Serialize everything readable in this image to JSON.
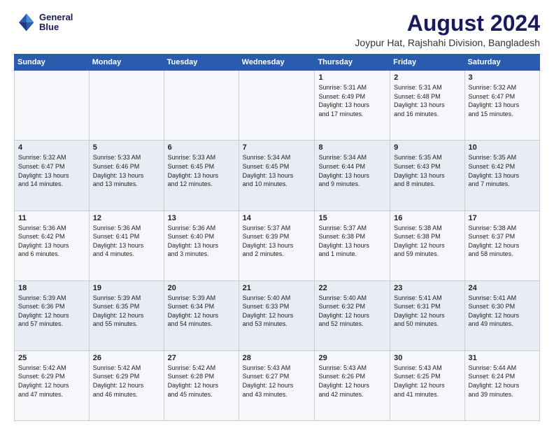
{
  "logo": {
    "line1": "General",
    "line2": "Blue"
  },
  "title": "August 2024",
  "subtitle": "Joypur Hat, Rajshahi Division, Bangladesh",
  "header_days": [
    "Sunday",
    "Monday",
    "Tuesday",
    "Wednesday",
    "Thursday",
    "Friday",
    "Saturday"
  ],
  "weeks": [
    [
      {
        "num": "",
        "info": ""
      },
      {
        "num": "",
        "info": ""
      },
      {
        "num": "",
        "info": ""
      },
      {
        "num": "",
        "info": ""
      },
      {
        "num": "1",
        "info": "Sunrise: 5:31 AM\nSunset: 6:49 PM\nDaylight: 13 hours\nand 17 minutes."
      },
      {
        "num": "2",
        "info": "Sunrise: 5:31 AM\nSunset: 6:48 PM\nDaylight: 13 hours\nand 16 minutes."
      },
      {
        "num": "3",
        "info": "Sunrise: 5:32 AM\nSunset: 6:47 PM\nDaylight: 13 hours\nand 15 minutes."
      }
    ],
    [
      {
        "num": "4",
        "info": "Sunrise: 5:32 AM\nSunset: 6:47 PM\nDaylight: 13 hours\nand 14 minutes."
      },
      {
        "num": "5",
        "info": "Sunrise: 5:33 AM\nSunset: 6:46 PM\nDaylight: 13 hours\nand 13 minutes."
      },
      {
        "num": "6",
        "info": "Sunrise: 5:33 AM\nSunset: 6:45 PM\nDaylight: 13 hours\nand 12 minutes."
      },
      {
        "num": "7",
        "info": "Sunrise: 5:34 AM\nSunset: 6:45 PM\nDaylight: 13 hours\nand 10 minutes."
      },
      {
        "num": "8",
        "info": "Sunrise: 5:34 AM\nSunset: 6:44 PM\nDaylight: 13 hours\nand 9 minutes."
      },
      {
        "num": "9",
        "info": "Sunrise: 5:35 AM\nSunset: 6:43 PM\nDaylight: 13 hours\nand 8 minutes."
      },
      {
        "num": "10",
        "info": "Sunrise: 5:35 AM\nSunset: 6:42 PM\nDaylight: 13 hours\nand 7 minutes."
      }
    ],
    [
      {
        "num": "11",
        "info": "Sunrise: 5:36 AM\nSunset: 6:42 PM\nDaylight: 13 hours\nand 6 minutes."
      },
      {
        "num": "12",
        "info": "Sunrise: 5:36 AM\nSunset: 6:41 PM\nDaylight: 13 hours\nand 4 minutes."
      },
      {
        "num": "13",
        "info": "Sunrise: 5:36 AM\nSunset: 6:40 PM\nDaylight: 13 hours\nand 3 minutes."
      },
      {
        "num": "14",
        "info": "Sunrise: 5:37 AM\nSunset: 6:39 PM\nDaylight: 13 hours\nand 2 minutes."
      },
      {
        "num": "15",
        "info": "Sunrise: 5:37 AM\nSunset: 6:38 PM\nDaylight: 13 hours\nand 1 minute."
      },
      {
        "num": "16",
        "info": "Sunrise: 5:38 AM\nSunset: 6:38 PM\nDaylight: 12 hours\nand 59 minutes."
      },
      {
        "num": "17",
        "info": "Sunrise: 5:38 AM\nSunset: 6:37 PM\nDaylight: 12 hours\nand 58 minutes."
      }
    ],
    [
      {
        "num": "18",
        "info": "Sunrise: 5:39 AM\nSunset: 6:36 PM\nDaylight: 12 hours\nand 57 minutes."
      },
      {
        "num": "19",
        "info": "Sunrise: 5:39 AM\nSunset: 6:35 PM\nDaylight: 12 hours\nand 55 minutes."
      },
      {
        "num": "20",
        "info": "Sunrise: 5:39 AM\nSunset: 6:34 PM\nDaylight: 12 hours\nand 54 minutes."
      },
      {
        "num": "21",
        "info": "Sunrise: 5:40 AM\nSunset: 6:33 PM\nDaylight: 12 hours\nand 53 minutes."
      },
      {
        "num": "22",
        "info": "Sunrise: 5:40 AM\nSunset: 6:32 PM\nDaylight: 12 hours\nand 52 minutes."
      },
      {
        "num": "23",
        "info": "Sunrise: 5:41 AM\nSunset: 6:31 PM\nDaylight: 12 hours\nand 50 minutes."
      },
      {
        "num": "24",
        "info": "Sunrise: 5:41 AM\nSunset: 6:30 PM\nDaylight: 12 hours\nand 49 minutes."
      }
    ],
    [
      {
        "num": "25",
        "info": "Sunrise: 5:42 AM\nSunset: 6:29 PM\nDaylight: 12 hours\nand 47 minutes."
      },
      {
        "num": "26",
        "info": "Sunrise: 5:42 AM\nSunset: 6:29 PM\nDaylight: 12 hours\nand 46 minutes."
      },
      {
        "num": "27",
        "info": "Sunrise: 5:42 AM\nSunset: 6:28 PM\nDaylight: 12 hours\nand 45 minutes."
      },
      {
        "num": "28",
        "info": "Sunrise: 5:43 AM\nSunset: 6:27 PM\nDaylight: 12 hours\nand 43 minutes."
      },
      {
        "num": "29",
        "info": "Sunrise: 5:43 AM\nSunset: 6:26 PM\nDaylight: 12 hours\nand 42 minutes."
      },
      {
        "num": "30",
        "info": "Sunrise: 5:43 AM\nSunset: 6:25 PM\nDaylight: 12 hours\nand 41 minutes."
      },
      {
        "num": "31",
        "info": "Sunrise: 5:44 AM\nSunset: 6:24 PM\nDaylight: 12 hours\nand 39 minutes."
      }
    ]
  ]
}
